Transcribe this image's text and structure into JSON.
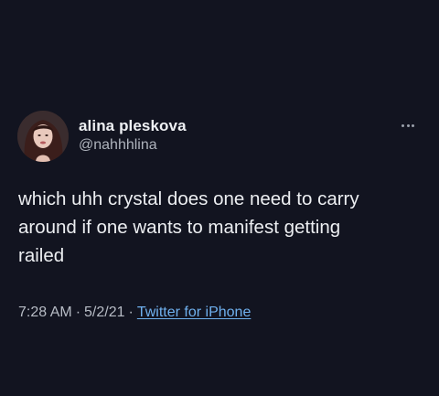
{
  "tweet": {
    "author": {
      "display_name": "alina pleskova",
      "handle": "@nahhhlina"
    },
    "more_icon": "more-horizontal-icon",
    "text": "which uhh crystal does one need to carry\naround if one wants to manifest getting\nrailed",
    "time": "7:28 AM",
    "separator_1": "·",
    "date": "5/2/21",
    "separator_2": "·",
    "source": "Twitter for iPhone"
  },
  "colors": {
    "background": "#121420",
    "text": "#eceef1",
    "secondary_text": "#aeb3bc",
    "link": "#6fb0ee"
  }
}
